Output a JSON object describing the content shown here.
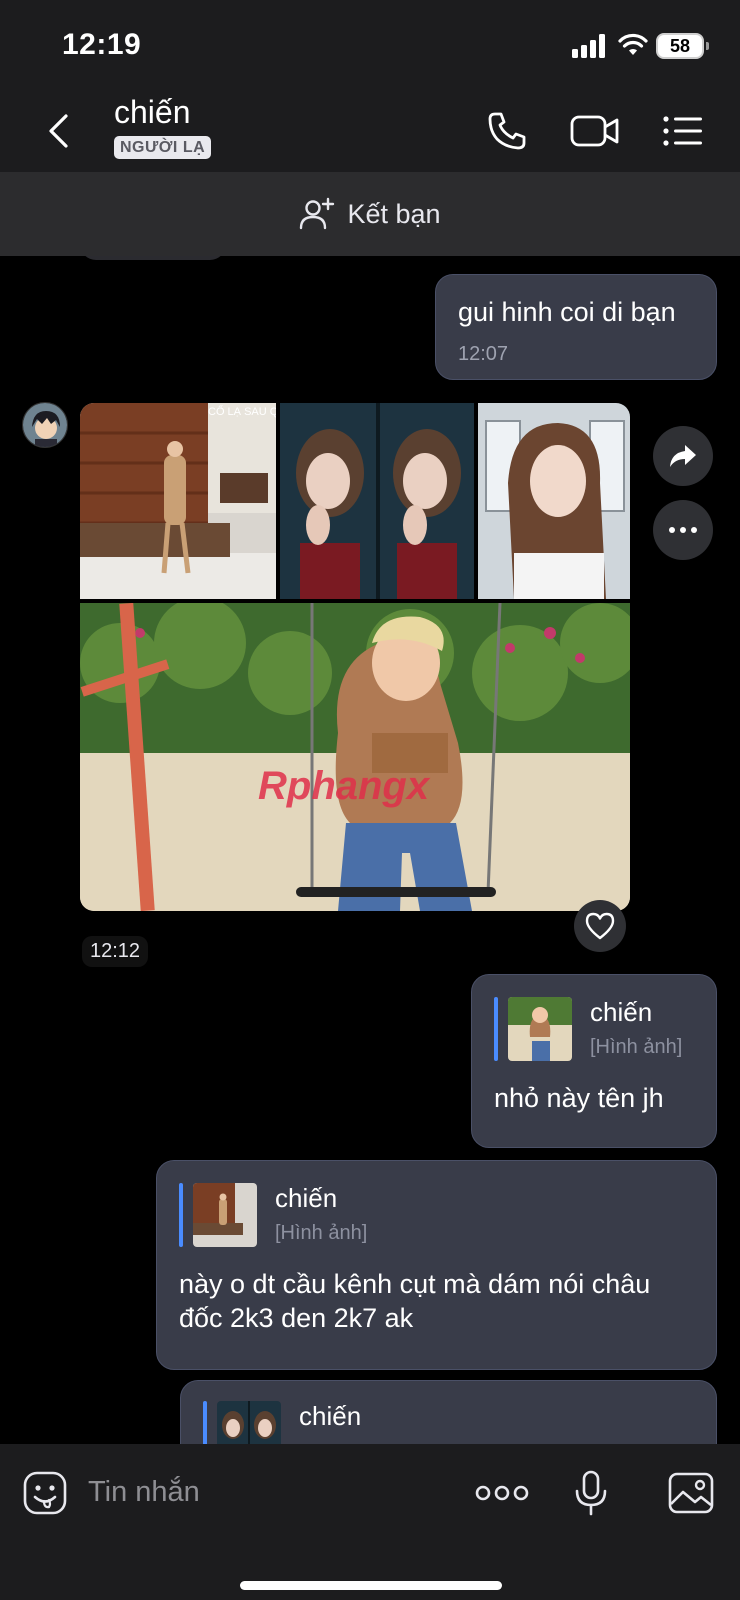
{
  "status_bar": {
    "time": "12:19",
    "battery": "58"
  },
  "header": {
    "contact_name": "chiến",
    "badge": "NGƯỜI LẠ",
    "icons": [
      "back-icon",
      "phone-icon",
      "video-call-icon",
      "menu-list-icon"
    ]
  },
  "add_friend": {
    "label": "Kết bạn",
    "icon": "add-user-icon"
  },
  "messages": {
    "m1": {
      "text": "gui hinh coi di bạn",
      "time": "12:07"
    },
    "images": {
      "time": "12:12",
      "watermark": "Rphangx",
      "sign_text": "CỔ LẠ SAU QUEN",
      "actions": [
        "share-icon",
        "more-icon",
        "heart-icon"
      ]
    },
    "m2": {
      "quote_name": "chiến",
      "quote_type": "[Hình ảnh]",
      "text": "nhỏ này tên jh"
    },
    "m3": {
      "quote_name": "chiến",
      "quote_type": "[Hình ảnh]",
      "text": "này o dt cầu kênh cụt mà dám nói châu đốc 2k3 den 2k7 ak"
    },
    "m4": {
      "quote_name": "chiến"
    }
  },
  "input_bar": {
    "placeholder": "Tin nhắn",
    "icons": [
      "sticker-icon",
      "more-options-icon",
      "microphone-icon",
      "gallery-icon"
    ]
  }
}
